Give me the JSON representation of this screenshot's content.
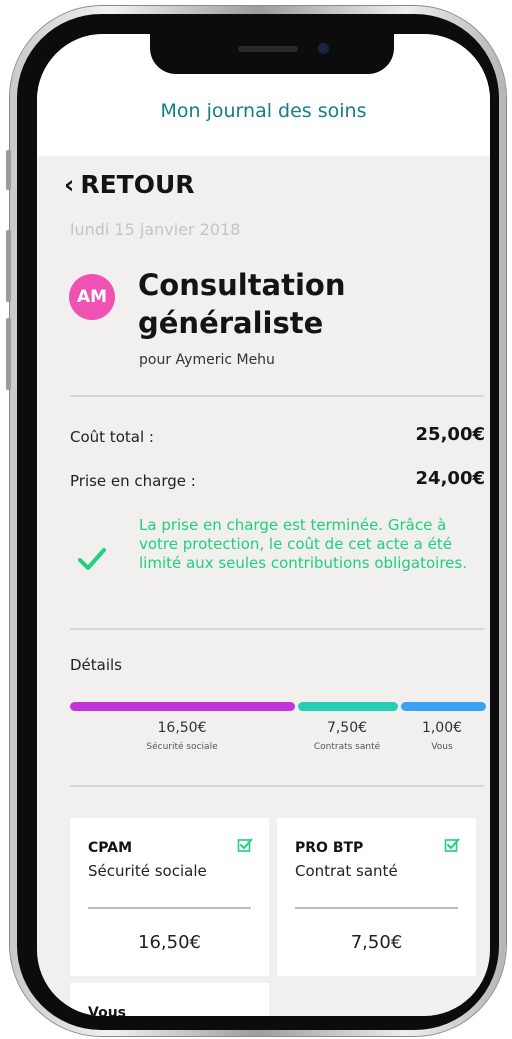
{
  "header": {
    "title": "Mon journal des soins"
  },
  "nav": {
    "back_chevron": "‹",
    "back_label": "RETOUR"
  },
  "date": "lundi 15 janvier 2018",
  "patient": {
    "initials": "AM",
    "avatar_color": "#f052b3",
    "title": "Consultation généraliste",
    "subtitle": "pour Aymeric Mehu"
  },
  "costs": {
    "total_label": "Coût total :",
    "total_value": "25,00€",
    "coverage_label": "Prise en charge :",
    "coverage_value": "24,00€"
  },
  "status": {
    "icon": "checkmark-icon",
    "color": "#20cf7f",
    "message": "La prise en charge est terminée. Grâce à votre protection, le coût de cet acte a été limité aux seules contributions obligatoires."
  },
  "details": {
    "label": "Détails",
    "segments": [
      {
        "amount": "16,50€",
        "label": "Sécurité sociale",
        "color": "#c335dc",
        "value": 16.5
      },
      {
        "amount": "7,50€",
        "label": "Contrats santé",
        "color": "#26cfb4",
        "value": 7.5
      },
      {
        "amount": "1,00€",
        "label": "Vous",
        "color": "#3aa2f0",
        "value": 1.0
      }
    ]
  },
  "cards": [
    {
      "title": "CPAM",
      "subtitle": "Sécurité sociale",
      "amount": "16,50€",
      "icon": "checkbox-checked-icon"
    },
    {
      "title": "PRO BTP",
      "subtitle": "Contrat santé",
      "amount": "7,50€",
      "icon": "checkbox-checked-icon"
    }
  ],
  "cards_partial": {
    "title": "Vous"
  },
  "accent_color": "#137e86"
}
